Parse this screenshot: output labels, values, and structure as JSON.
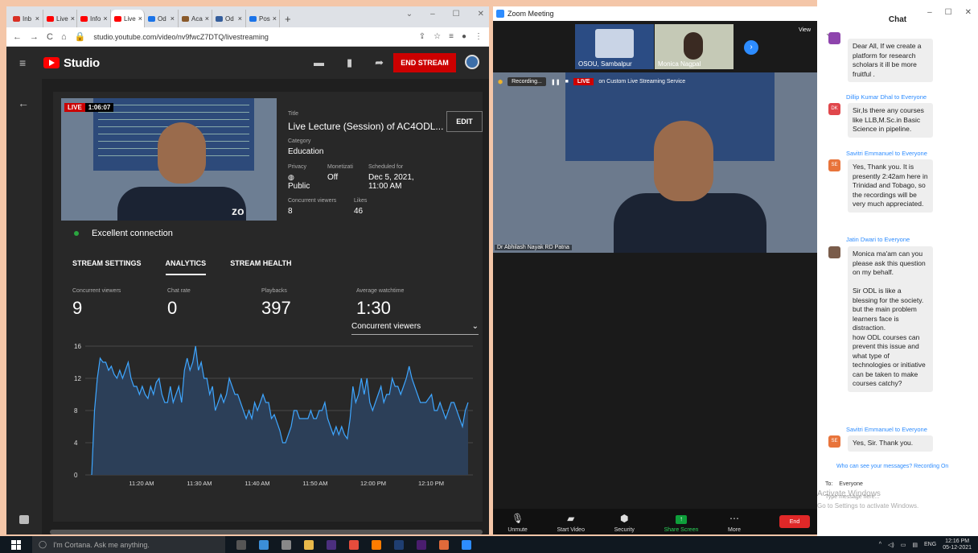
{
  "browser": {
    "tabs": [
      {
        "label": "Inb",
        "color": "#d93025"
      },
      {
        "label": "Live",
        "color": "#ff0000"
      },
      {
        "label": "Info",
        "color": "#ff0000"
      },
      {
        "label": "Live",
        "color": "#ff0000"
      },
      {
        "label": "Od",
        "color": "#1a73e8"
      },
      {
        "label": "Aca",
        "color": "#8a5a2b"
      },
      {
        "label": "Od",
        "color": "#355e9c"
      },
      {
        "label": "Pos",
        "color": "#1a73e8"
      }
    ],
    "new_tab": "+",
    "url": "studio.youtube.com/video/nv9fwcZ7DTQ/livestreaming"
  },
  "studio": {
    "brand": "Studio",
    "end_stream": "END STREAM",
    "live_label": "LIVE",
    "live_time": "1:06:07",
    "watermark": "zo",
    "title_label": "Title",
    "title": "Live Lecture (Session) of AC4ODL...",
    "edit": "EDIT",
    "category_label": "Category",
    "category": "Education",
    "privacy_label": "Privacy",
    "privacy": "Public",
    "monetization_label": "Monetizati",
    "monetization": "Off",
    "scheduled_label": "Scheduled for",
    "scheduled_date": "Dec 5, 2021,",
    "scheduled_time": "11:00 AM",
    "viewers_label": "Concurrent viewers",
    "viewers": "8",
    "likes_label": "Likes",
    "likes": "46",
    "connection": "Excellent connection",
    "tabs": [
      "STREAM SETTINGS",
      "ANALYTICS",
      "STREAM HEALTH"
    ],
    "stats": [
      {
        "label": "Concurrent viewers",
        "value": "9"
      },
      {
        "label": "Chat rate",
        "value": "0"
      },
      {
        "label": "Playbacks",
        "value": "397"
      },
      {
        "label": "Average watchtime",
        "value": "1:30"
      }
    ],
    "dropdown": "Concurrent viewers"
  },
  "chart_data": {
    "type": "area",
    "title": "",
    "xlabel": "",
    "ylabel": "",
    "ylim": [
      0,
      16
    ],
    "yticks": [
      "0",
      "4",
      "8",
      "12",
      "16"
    ],
    "xticks": [
      "11:20 AM",
      "11:30 AM",
      "11:40 AM",
      "11:50 AM",
      "12:00 PM",
      "12:10 PM"
    ],
    "series": [
      {
        "values": [
          0,
          8,
          12,
          14.5,
          14,
          14,
          13,
          13.5,
          12.5,
          12,
          13,
          12,
          13,
          14,
          12,
          11,
          11,
          10,
          11,
          10,
          9.5,
          11,
          10,
          11.5,
          12,
          10,
          9,
          9,
          11,
          9,
          10,
          11,
          9,
          13,
          14.5,
          13,
          14,
          16,
          13,
          14,
          12,
          12,
          10,
          11,
          8,
          9,
          10,
          9,
          10,
          12,
          11,
          10,
          10,
          9,
          8,
          7,
          8,
          7,
          9,
          8,
          9,
          10,
          9,
          9,
          7,
          7.5,
          6.5,
          5.5,
          4,
          4,
          5,
          6,
          8,
          8,
          7,
          7,
          7,
          7,
          8,
          7,
          7,
          8,
          8,
          9,
          7,
          6,
          5,
          6,
          5,
          6,
          5,
          4.5,
          7,
          11,
          9,
          10,
          12,
          10,
          12,
          9,
          8,
          9,
          10,
          11,
          9,
          10,
          10,
          12,
          11,
          11,
          10,
          11,
          12,
          13.5,
          12,
          11,
          10,
          9,
          9,
          9,
          9.5,
          10,
          8,
          8,
          9,
          8,
          7,
          8,
          9,
          9,
          8,
          7,
          6,
          8,
          9
        ]
      }
    ]
  },
  "zoom": {
    "window_title": "Zoom Meeting",
    "participants": [
      {
        "name": "OSOU, Sambalpur"
      },
      {
        "name": "Monica Nagpal"
      }
    ],
    "view": "View",
    "recording": "Recording...",
    "live_label": "LIVE",
    "streaming_service": "on Custom Live Streaming Service",
    "speaker_name": "Dr Abhilash Nayak RD Patna",
    "toolbar": [
      "Unmute",
      "Start Video",
      "Security",
      "Share Screen",
      "More"
    ],
    "end": "End"
  },
  "chat": {
    "title": "Chat",
    "messages": [
      {
        "from": "",
        "initials": "",
        "color": "#8e44ad",
        "text": "Dear All, If we create a platform for research scholars it ill be more fruitful ."
      },
      {
        "from": "Dillip Kumar Dhal to Everyone",
        "initials": "DK",
        "color": "#e0474c",
        "text": "Sir,Is there any courses like LLB,M.Sc.in Basic Science in pipeline."
      },
      {
        "from": "Savitri Emmanuel to Everyone",
        "initials": "SE",
        "color": "#e8743b",
        "text": "Yes, Thank you. It is presently 2:42am here in Trinidad and Tobago, so the recordings will be very much appreciated."
      },
      {
        "from": "Jatin Dwari to Everyone",
        "initials": "",
        "color": "#7a5c4a",
        "text": "Monica ma'am can you please ask this question on my behalf.\n\nSir ODL is like a blessing for the society. but the main problem learners face is distraction.\nhow ODL courses can prevent this issue and what type of technologies or initiative can be taken to make courses catchy?"
      },
      {
        "from": "Savitri Emmanuel to Everyone",
        "initials": "SE",
        "color": "#e8743b",
        "text": "Yes, Sir. Thank you."
      }
    ],
    "note": "Who can see your messages? Recording On",
    "to_label": "To:",
    "to_value": "Everyone",
    "placeholder": "Type message here...",
    "activate1": "Activate Windows",
    "activate2": "Go to Settings to activate Windows."
  },
  "taskbar": {
    "cortana": "I'm Cortana. Ask me anything.",
    "lang": "ENG",
    "time": "12:16 PM",
    "date": "05-12-2021"
  }
}
